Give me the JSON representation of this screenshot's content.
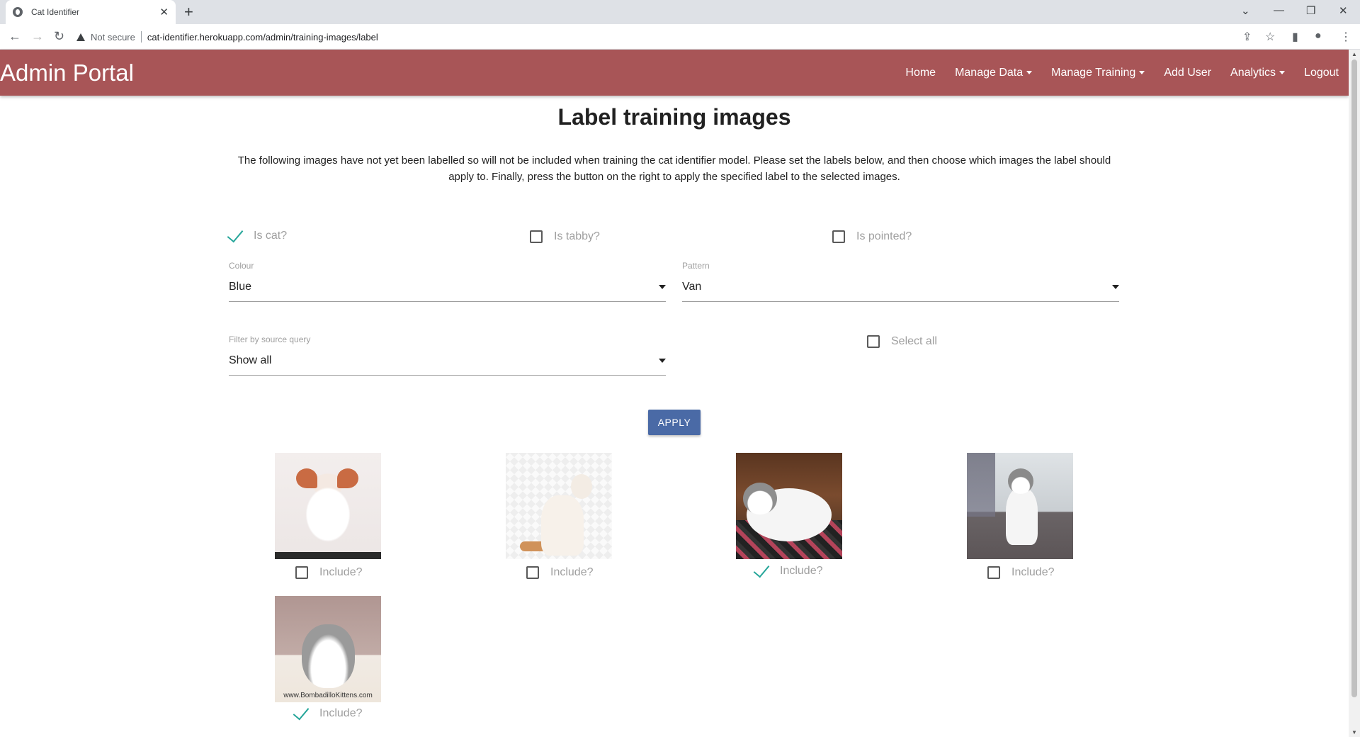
{
  "browser": {
    "tab_title": "Cat Identifier",
    "security_label": "Not secure",
    "url": "cat-identifier.herokuapp.com/admin/training-images/label"
  },
  "nav": {
    "brand": "Admin Portal",
    "home": "Home",
    "manage_data": "Manage Data",
    "manage_training": "Manage Training",
    "add_user": "Add User",
    "analytics": "Analytics",
    "logout": "Logout"
  },
  "page": {
    "title": "Label training images",
    "intro": "The following images have not yet been labelled so will not be included when training the cat identifier model. Please set the labels below, and then choose which images the label should apply to. Finally, press the button on the right to apply the specified label to the selected images."
  },
  "labels": {
    "is_cat": {
      "label": "Is cat?",
      "checked": true
    },
    "is_tabby": {
      "label": "Is tabby?",
      "checked": false
    },
    "is_pointed": {
      "label": "Is pointed?",
      "checked": false
    }
  },
  "colour": {
    "label": "Colour",
    "value": "Blue"
  },
  "pattern": {
    "label": "Pattern",
    "value": "Van"
  },
  "filter": {
    "label": "Filter by source query",
    "value": "Show all"
  },
  "select_all": {
    "label": "Select all",
    "checked": false
  },
  "apply_label": "APPLY",
  "images": [
    {
      "include_label": "Include?",
      "checked": false
    },
    {
      "include_label": "Include?",
      "checked": false
    },
    {
      "include_label": "Include?",
      "checked": true
    },
    {
      "include_label": "Include?",
      "checked": false
    },
    {
      "include_label": "Include?",
      "checked": true,
      "caption": "www.BombadilloKittens.com"
    }
  ]
}
